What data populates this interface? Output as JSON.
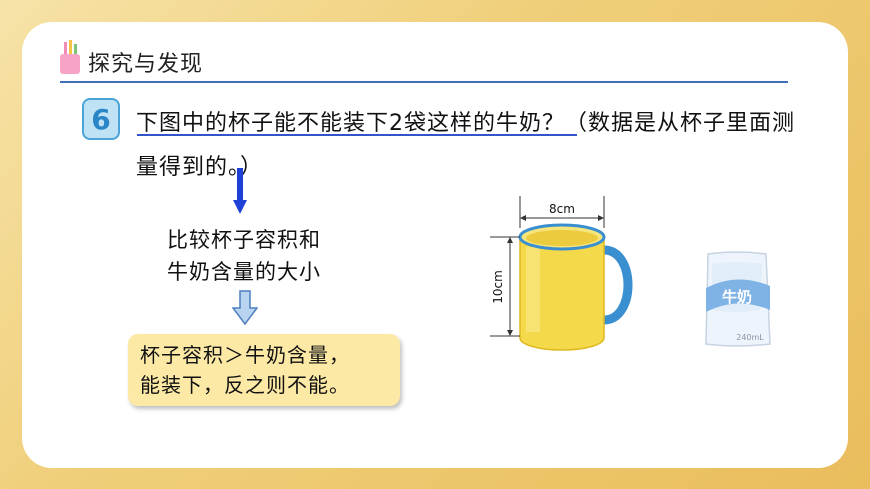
{
  "section": {
    "title": "探究与发现"
  },
  "question": {
    "number": "6",
    "text": "下图中的杯子能不能装下2袋这样的牛奶？（数据是从杯子里面测量得到的。）"
  },
  "analysis": {
    "line1": "比较杯子容积和",
    "line2": "牛奶含量的大小"
  },
  "conclusion": {
    "line1": "杯子容积＞牛奶含量，",
    "line2": "能装下，反之则不能。"
  },
  "cup": {
    "diameter_label": "8cm",
    "height_label": "10cm"
  },
  "milk": {
    "label": "牛奶",
    "volume": "240mL"
  },
  "colors": {
    "accent_blue": "#3f6fb5",
    "cup_yellow": "#f4d94a",
    "handle_blue": "#3a8fd0",
    "conclusion_bg": "#fde9a6"
  }
}
